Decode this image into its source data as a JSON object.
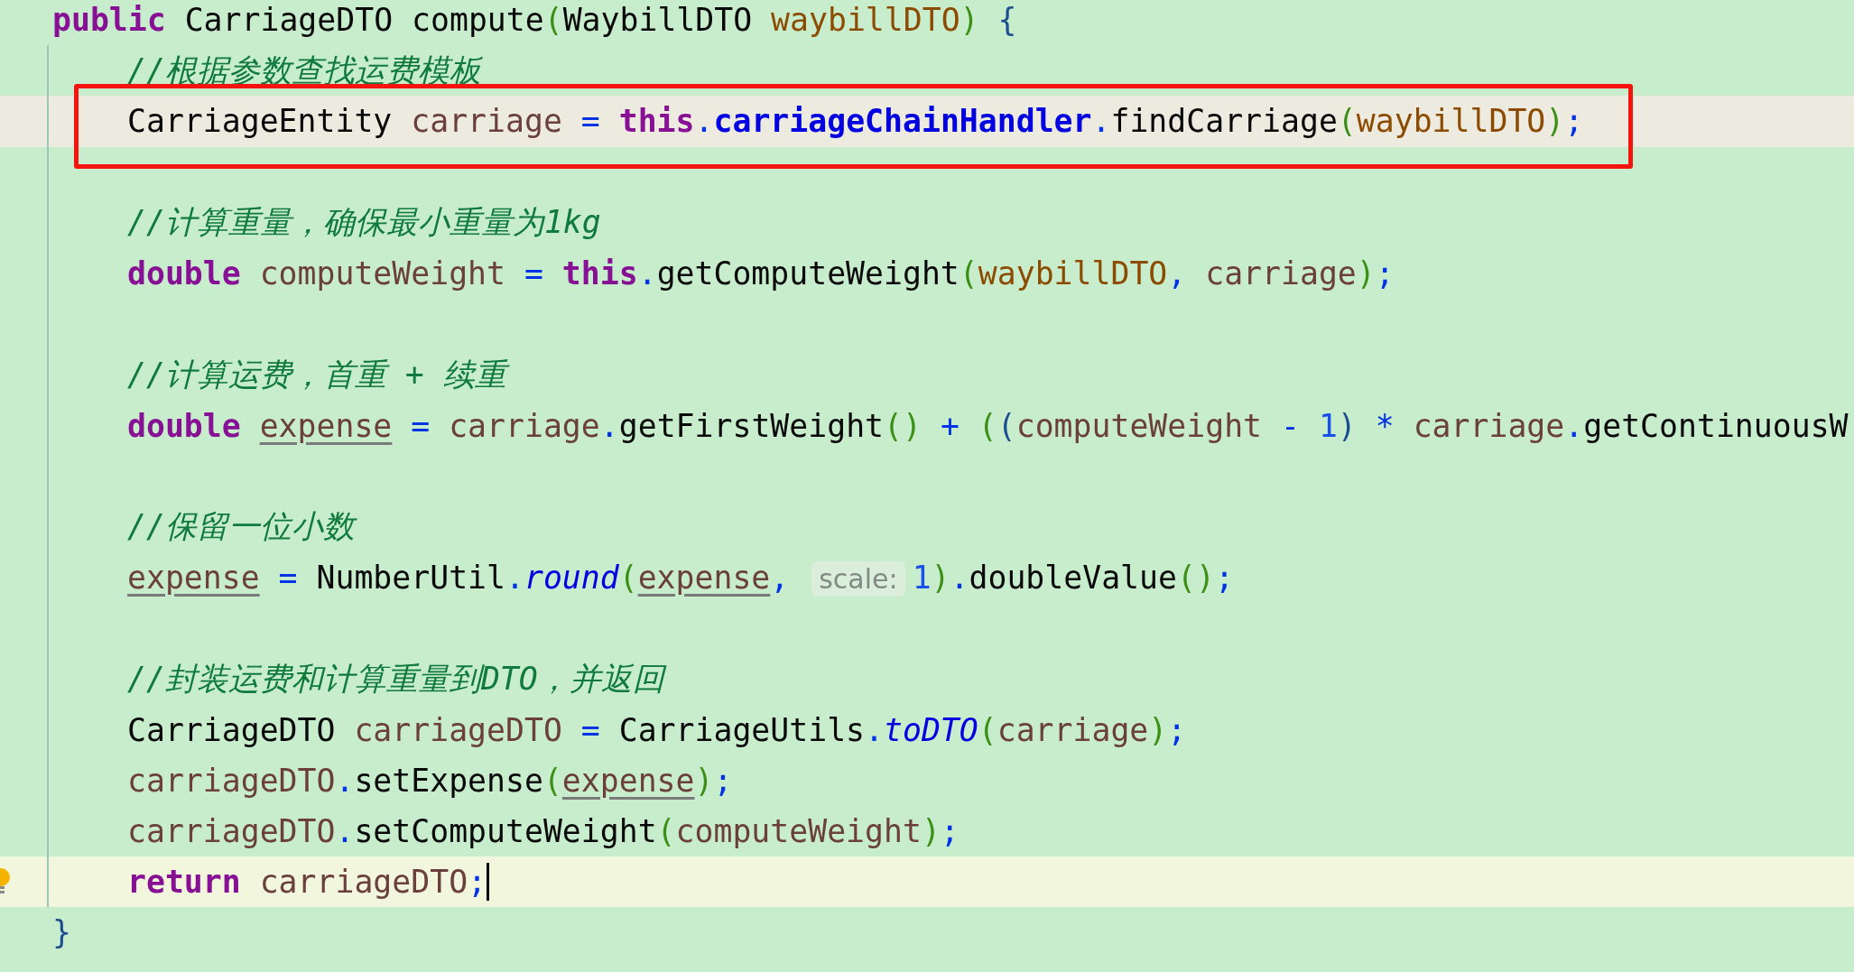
{
  "editor": {
    "lines": [
      {
        "kind": "signature",
        "tokens": [
          {
            "text": "public",
            "kind": "kw"
          },
          {
            "text": " CarriageDTO compute",
            "kind": "plain"
          },
          {
            "text": "(",
            "kind": "paren"
          },
          {
            "text": "WaybillDTO ",
            "kind": "plain"
          },
          {
            "text": "waybillDTO",
            "kind": "param"
          },
          {
            "text": ")",
            "kind": "paren"
          },
          {
            "text": " {",
            "kind": "brace"
          }
        ]
      },
      {
        "kind": "body",
        "tokens": [
          {
            "text": "//根据参数查找运费模板",
            "kind": "comment"
          }
        ]
      },
      {
        "kind": "body",
        "marked": true,
        "boxed": true,
        "tokens": [
          {
            "text": "CarriageEntity ",
            "kind": "plain"
          },
          {
            "text": "carriage",
            "kind": "local"
          },
          {
            "text": " = ",
            "kind": "op"
          },
          {
            "text": "this",
            "kind": "kw"
          },
          {
            "text": ".",
            "kind": "op"
          },
          {
            "text": "carriageChainHandler",
            "kind": "field"
          },
          {
            "text": ".",
            "kind": "op"
          },
          {
            "text": "findCarriage",
            "kind": "plain"
          },
          {
            "text": "(",
            "kind": "paren"
          },
          {
            "text": "waybillDTO",
            "kind": "param"
          },
          {
            "text": ")",
            "kind": "paren"
          },
          {
            "text": ";",
            "kind": "op"
          }
        ]
      },
      {
        "kind": "blank"
      },
      {
        "kind": "body",
        "tokens": [
          {
            "text": "//计算重量，确保最小重量为1kg",
            "kind": "comment"
          }
        ]
      },
      {
        "kind": "body",
        "tokens": [
          {
            "text": "double",
            "kind": "kw"
          },
          {
            "text": " computeWeight",
            "kind": "local"
          },
          {
            "text": " = ",
            "kind": "op"
          },
          {
            "text": "this",
            "kind": "kw"
          },
          {
            "text": ".",
            "kind": "op"
          },
          {
            "text": "getComputeWeight",
            "kind": "plain"
          },
          {
            "text": "(",
            "kind": "paren"
          },
          {
            "text": "waybillDTO",
            "kind": "param"
          },
          {
            "text": ", ",
            "kind": "op"
          },
          {
            "text": "carriage",
            "kind": "local"
          },
          {
            "text": ")",
            "kind": "paren"
          },
          {
            "text": ";",
            "kind": "op"
          }
        ]
      },
      {
        "kind": "blank"
      },
      {
        "kind": "body",
        "tokens": [
          {
            "text": "//计算运费，首重 + 续重",
            "kind": "comment"
          }
        ]
      },
      {
        "kind": "body",
        "tokens": [
          {
            "text": "double ",
            "kind": "kw"
          },
          {
            "text": "expense",
            "kind": "reassigned"
          },
          {
            "text": " = ",
            "kind": "op"
          },
          {
            "text": "carriage",
            "kind": "local"
          },
          {
            "text": ".",
            "kind": "op"
          },
          {
            "text": "getFirstWeight",
            "kind": "plain"
          },
          {
            "text": "()",
            "kind": "paren"
          },
          {
            "text": " + ",
            "kind": "op"
          },
          {
            "text": "(",
            "kind": "paren"
          },
          {
            "text": "(",
            "kind": "brace"
          },
          {
            "text": "computeWeight",
            "kind": "local"
          },
          {
            "text": " - ",
            "kind": "op"
          },
          {
            "text": "1",
            "kind": "num"
          },
          {
            "text": ")",
            "kind": "brace"
          },
          {
            "text": " * ",
            "kind": "op"
          },
          {
            "text": "carriage",
            "kind": "local"
          },
          {
            "text": ".",
            "kind": "op"
          },
          {
            "text": "getContinuousW",
            "kind": "plain"
          }
        ]
      },
      {
        "kind": "blank"
      },
      {
        "kind": "body",
        "tokens": [
          {
            "text": "//保留一位小数",
            "kind": "comment"
          }
        ]
      },
      {
        "kind": "body",
        "tokens": [
          {
            "text": "expense",
            "kind": "reassigned"
          },
          {
            "text": " = ",
            "kind": "op"
          },
          {
            "text": "NumberUtil",
            "kind": "plain"
          },
          {
            "text": ".",
            "kind": "op"
          },
          {
            "text": "round",
            "kind": "static"
          },
          {
            "text": "(",
            "kind": "paren"
          },
          {
            "text": "expense",
            "kind": "reassigned"
          },
          {
            "text": ", ",
            "kind": "op"
          },
          {
            "text": "scale:",
            "kind": "hint"
          },
          {
            "text": "1",
            "kind": "num"
          },
          {
            "text": ")",
            "kind": "paren"
          },
          {
            "text": ".",
            "kind": "op"
          },
          {
            "text": "doubleValue",
            "kind": "plain"
          },
          {
            "text": "()",
            "kind": "paren"
          },
          {
            "text": ";",
            "kind": "op"
          }
        ]
      },
      {
        "kind": "blank"
      },
      {
        "kind": "body",
        "tokens": [
          {
            "text": "//封装运费和计算重量到DTO，并返回",
            "kind": "comment"
          }
        ]
      },
      {
        "kind": "body",
        "tokens": [
          {
            "text": "CarriageDTO ",
            "kind": "plain"
          },
          {
            "text": "carriageDTO",
            "kind": "local"
          },
          {
            "text": " = ",
            "kind": "op"
          },
          {
            "text": "CarriageUtils",
            "kind": "plain"
          },
          {
            "text": ".",
            "kind": "op"
          },
          {
            "text": "toDTO",
            "kind": "static"
          },
          {
            "text": "(",
            "kind": "paren"
          },
          {
            "text": "carriage",
            "kind": "local"
          },
          {
            "text": ")",
            "kind": "paren"
          },
          {
            "text": ";",
            "kind": "op"
          }
        ]
      },
      {
        "kind": "body",
        "tokens": [
          {
            "text": "carriageDTO",
            "kind": "local"
          },
          {
            "text": ".",
            "kind": "op"
          },
          {
            "text": "setExpense",
            "kind": "plain"
          },
          {
            "text": "(",
            "kind": "paren"
          },
          {
            "text": "expense",
            "kind": "reassigned"
          },
          {
            "text": ")",
            "kind": "paren"
          },
          {
            "text": ";",
            "kind": "op"
          }
        ]
      },
      {
        "kind": "body",
        "tokens": [
          {
            "text": "carriageDTO",
            "kind": "local"
          },
          {
            "text": ".",
            "kind": "op"
          },
          {
            "text": "setComputeWeight",
            "kind": "plain"
          },
          {
            "text": "(",
            "kind": "paren"
          },
          {
            "text": "computeWeight",
            "kind": "local"
          },
          {
            "text": ")",
            "kind": "paren"
          },
          {
            "text": ";",
            "kind": "op"
          }
        ]
      },
      {
        "kind": "body",
        "current": true,
        "caret": true,
        "bulb": true,
        "tokens": [
          {
            "text": "return",
            "kind": "kw"
          },
          {
            "text": " carriageDTO",
            "kind": "local"
          },
          {
            "text": ";",
            "kind": "op"
          }
        ]
      },
      {
        "kind": "close",
        "tokens": [
          {
            "text": "}",
            "kind": "brace"
          }
        ]
      }
    ]
  }
}
